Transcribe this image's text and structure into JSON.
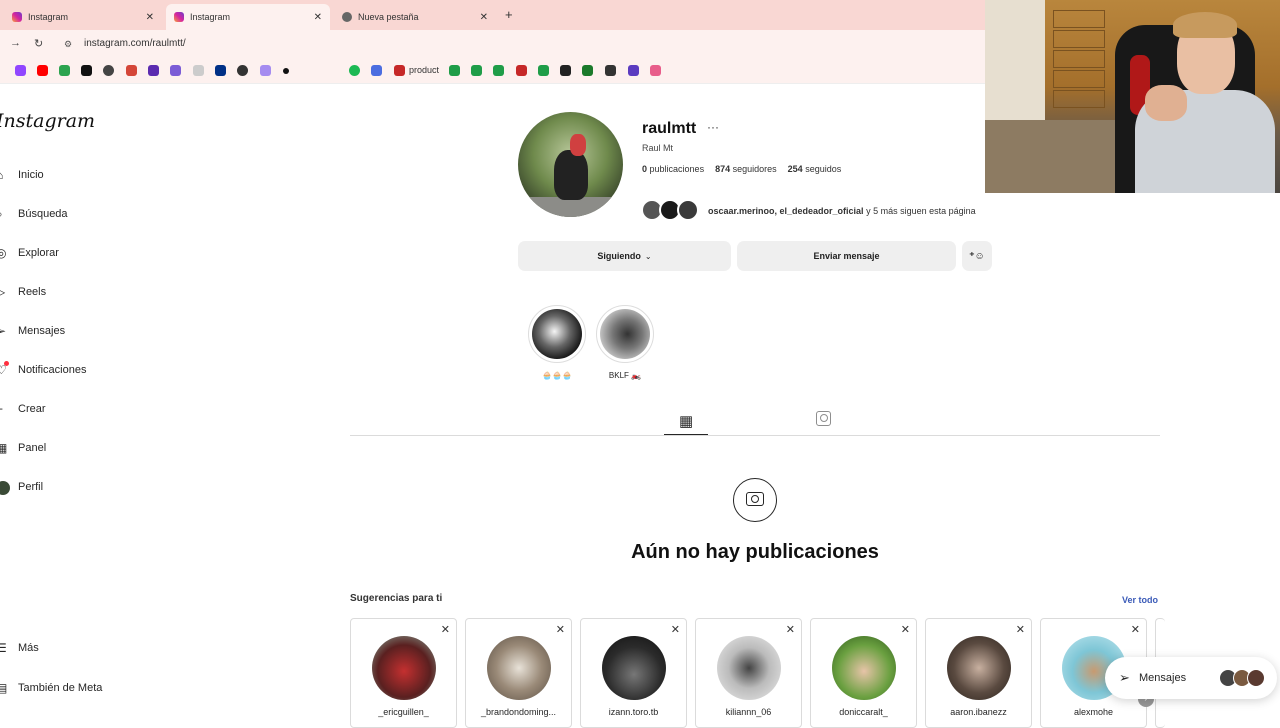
{
  "browser": {
    "tabs": [
      {
        "label": "Instagram",
        "active": false
      },
      {
        "label": "Instagram",
        "active": true
      },
      {
        "label": "Nueva pestaña",
        "active": false
      }
    ],
    "new_tab": "+",
    "url": "instagram.com/raulmtt/",
    "bookmark_text": "product"
  },
  "sidebar": {
    "logo": "Instagram",
    "items": [
      {
        "label": "Inicio",
        "icon": "home-icon"
      },
      {
        "label": "Búsqueda",
        "icon": "search-icon"
      },
      {
        "label": "Explorar",
        "icon": "compass-icon"
      },
      {
        "label": "Reels",
        "icon": "reels-icon"
      },
      {
        "label": "Mensajes",
        "icon": "send-icon"
      },
      {
        "label": "Notificaciones",
        "icon": "heart-icon"
      },
      {
        "label": "Crear",
        "icon": "plus-icon"
      },
      {
        "label": "Panel",
        "icon": "dashboard-icon"
      },
      {
        "label": "Perfil",
        "icon": "avatar-icon"
      }
    ],
    "more": "Más",
    "meta": "También de Meta"
  },
  "profile": {
    "username": "raulmtt",
    "options": "···",
    "full_name": "Raul Mt",
    "posts_count": "0",
    "posts_label": "publicaciones",
    "followers_count": "874",
    "followers_label": "seguidores",
    "following_count": "254",
    "following_label": "seguidos",
    "mutual_names": "oscaar.merinoo, el_dedeador_oficial",
    "mutual_rest": " y 5 más siguen esta página",
    "following_button": "Siguiendo",
    "message_button": "Enviar mensaje"
  },
  "highlights": [
    {
      "label": "🧁🧁🧁"
    },
    {
      "label": "BKLF 🏍️"
    }
  ],
  "empty_state": {
    "title": "Aún no hay publicaciones"
  },
  "suggestions": {
    "title": "Sugerencias para ti",
    "see_all": "Ver todo",
    "cards": [
      {
        "name": "_ericguillen_",
        "color": "#8a3030"
      },
      {
        "name": "_brandondoming...",
        "color": "#9a8a78"
      },
      {
        "name": "izann.toro.tb",
        "color": "#2b2b2b"
      },
      {
        "name": "kiliannn_06",
        "color": "#cfcfcf"
      },
      {
        "name": "doniccaralt_",
        "color": "#4f8a2f"
      },
      {
        "name": "aaron.ibanezz",
        "color": "#5a4a40"
      },
      {
        "name": "alexmohe",
        "color": "#7ec6d6"
      }
    ]
  },
  "messages_pill": {
    "label": "Mensajes"
  },
  "colors": {
    "tabbar": "#f9d7d3",
    "link": "#3b5bb8",
    "button_bg": "#efefef"
  }
}
